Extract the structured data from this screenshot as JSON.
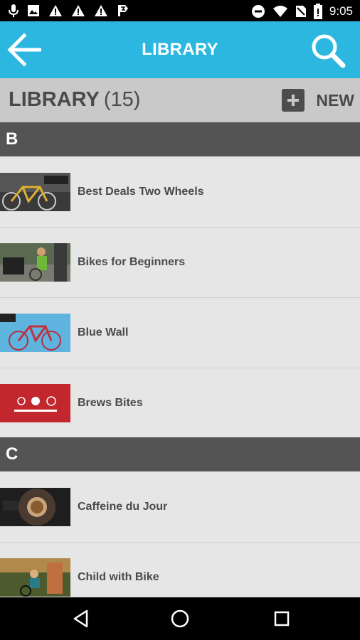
{
  "status_bar": {
    "time": "9:05",
    "left_icons": [
      "mic-icon",
      "image-icon",
      "warning-icon",
      "warning-icon",
      "warning-icon",
      "flag-icon"
    ],
    "right_icons": [
      "do-not-disturb-icon",
      "wifi-icon",
      "no-sim-icon",
      "battery-icon"
    ]
  },
  "app_bar": {
    "title": "LIBRARY",
    "back_icon": "arrow-left-icon",
    "search_icon": "search-icon",
    "color": "#2cb7e0"
  },
  "library_header": {
    "label": "LIBRARY",
    "count": "(15)",
    "new_label": "NEW"
  },
  "sections": [
    {
      "letter": "B",
      "items": [
        {
          "name": "Best Deals Two Wheels"
        },
        {
          "name": "Bikes for Beginners"
        },
        {
          "name": "Blue Wall"
        },
        {
          "name": "Brews Bites"
        }
      ]
    },
    {
      "letter": "C",
      "items": [
        {
          "name": "Caffeine du Jour"
        },
        {
          "name": "Child with Bike"
        }
      ]
    }
  ],
  "nav_bar": {
    "icons": [
      "back-triangle-icon",
      "home-circle-icon",
      "recents-square-icon"
    ]
  }
}
